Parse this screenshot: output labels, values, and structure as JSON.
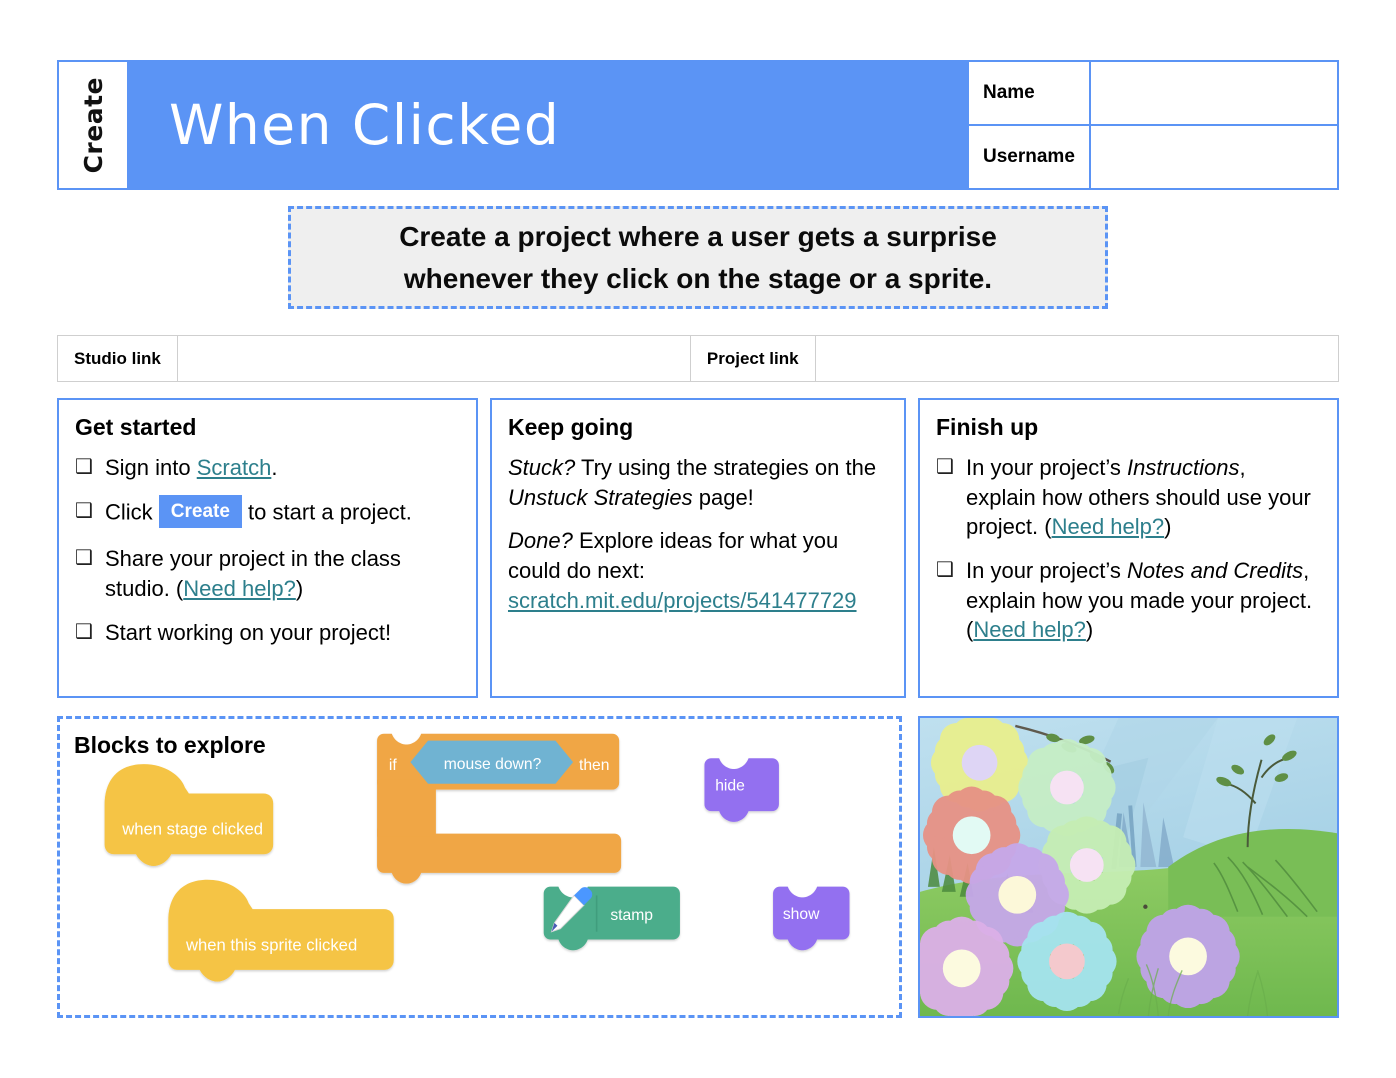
{
  "header": {
    "tab_label": "Create",
    "title": "When Clicked",
    "fields": [
      {
        "label": "Name",
        "value": ""
      },
      {
        "label": "Username",
        "value": ""
      }
    ]
  },
  "prompt": {
    "line1": "Create a project where a user gets a surprise",
    "line2": "whenever they click on the stage or a sprite."
  },
  "links_row": {
    "studio_label": "Studio link",
    "studio_value": "",
    "project_label": "Project link",
    "project_value": ""
  },
  "get_started": {
    "title": "Get started",
    "items": [
      {
        "checkbox": "❑",
        "pre": "Sign into ",
        "link": "Scratch",
        "post": "."
      },
      {
        "checkbox": "❑",
        "pre": "Click ",
        "badge": "Create",
        "post": " to start a project."
      },
      {
        "checkbox": "❑",
        "pre": "Share your project in the class studio. (",
        "link": "Need help?",
        "post": ")"
      },
      {
        "checkbox": "❑",
        "pre": "Start working on your project!",
        "post": ""
      }
    ]
  },
  "keep_going": {
    "title": "Keep going",
    "p1_em": "Stuck?",
    "p1_rest": " Try using the strategies on the ",
    "p1_em2": "Unstuck Strategies",
    "p1_tail": " page!",
    "p2_em": "Done?",
    "p2_rest": " Explore ideas for what you could do next:",
    "p2_link": "scratch.mit.edu/projects/541477729"
  },
  "finish_up": {
    "title": "Finish up",
    "items": [
      {
        "checkbox": "❑",
        "pre": "In your project’s ",
        "em": "Instructions",
        "mid": ", explain how others should use your project. (",
        "link": "Need help?",
        "post": ")"
      },
      {
        "checkbox": "❑",
        "pre": "In your project’s ",
        "em": "Notes and Credits",
        "mid": ", explain how you made your project. (",
        "link": "Need help?",
        "post": ")"
      }
    ]
  },
  "blocks_panel": {
    "title": "Blocks to explore",
    "blocks": [
      {
        "name": "when-stage-clicked",
        "label": "when stage clicked",
        "category": "events",
        "color": "#f5c444"
      },
      {
        "name": "when-this-sprite-clicked",
        "label": "when this sprite clicked",
        "category": "events",
        "color": "#f5c444"
      },
      {
        "name": "if-then",
        "label_if": "if",
        "label_then": "then",
        "category": "control",
        "color": "#f0a644"
      },
      {
        "name": "mouse-down",
        "label": "mouse down?",
        "category": "sensing",
        "color": "#6fb3d2"
      },
      {
        "name": "stamp",
        "label": "stamp",
        "category": "pen",
        "color": "#4bad8b"
      },
      {
        "name": "hide",
        "label": "hide",
        "category": "looks",
        "color": "#9370f0"
      },
      {
        "name": "show",
        "label": "show",
        "category": "looks",
        "color": "#9370f0"
      }
    ]
  },
  "thumbnail": {
    "alt": "garden backdrop with stamped flowers on grass",
    "sky_color": "#a9d4e8",
    "grass_color": "#86c95e"
  },
  "colors": {
    "accent_blue": "#5b94f5",
    "link_teal": "#2d7f8c",
    "prompt_bg": "#efefef",
    "table_border": "#cfcfcf"
  }
}
